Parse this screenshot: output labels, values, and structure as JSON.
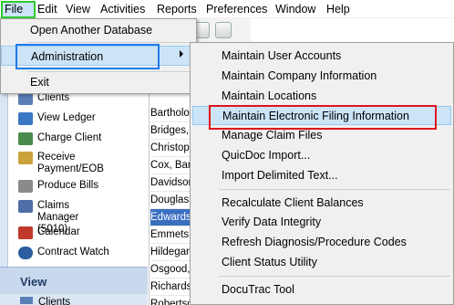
{
  "menubar": {
    "items": [
      "File",
      "Edit",
      "View",
      "Activities",
      "Reports",
      "Preferences",
      "Window",
      "Help"
    ]
  },
  "file_menu": {
    "items": [
      "Open Another Database",
      "Administration",
      "Exit"
    ]
  },
  "admin_submenu": {
    "groups": [
      [
        "Maintain User Accounts",
        "Maintain Company Information",
        "Maintain Locations",
        "Maintain Electronic Filing Information",
        "Manage Claim Files",
        "QuicDoc Import...",
        "Import Delimited Text..."
      ],
      [
        "Recalculate Client Balances",
        "Verify Data Integrity",
        "Refresh Diagnosis/Procedure Codes",
        "Client Status Utility"
      ],
      [
        "DocuTrac Tool"
      ]
    ],
    "highlighted": "Maintain Electronic Filing Information"
  },
  "sidebar": {
    "items": [
      "Clients",
      "View Ledger",
      "Charge Client",
      "Receive Payment/EOB",
      "Produce Bills",
      "Claims Manager (5010)",
      "Calendar",
      "Contract Watch"
    ],
    "view_header": "View",
    "view_items": [
      "Clients"
    ]
  },
  "client_list": {
    "names": [
      "Bartholo",
      "Bridges, I",
      "Christoph",
      "Cox, Barb",
      "Davidsor",
      "Douglass",
      "Edwards,",
      "Emmets,",
      "Hildegard",
      "Osgood,",
      "Richards",
      "Robertso"
    ],
    "selected_index": 6
  },
  "colors": {
    "highlight_file": "#2ecc2e",
    "highlight_admin": "#1f7be8",
    "highlight_efiling": "#e0141e",
    "selected_row": "#3a6fc0"
  }
}
